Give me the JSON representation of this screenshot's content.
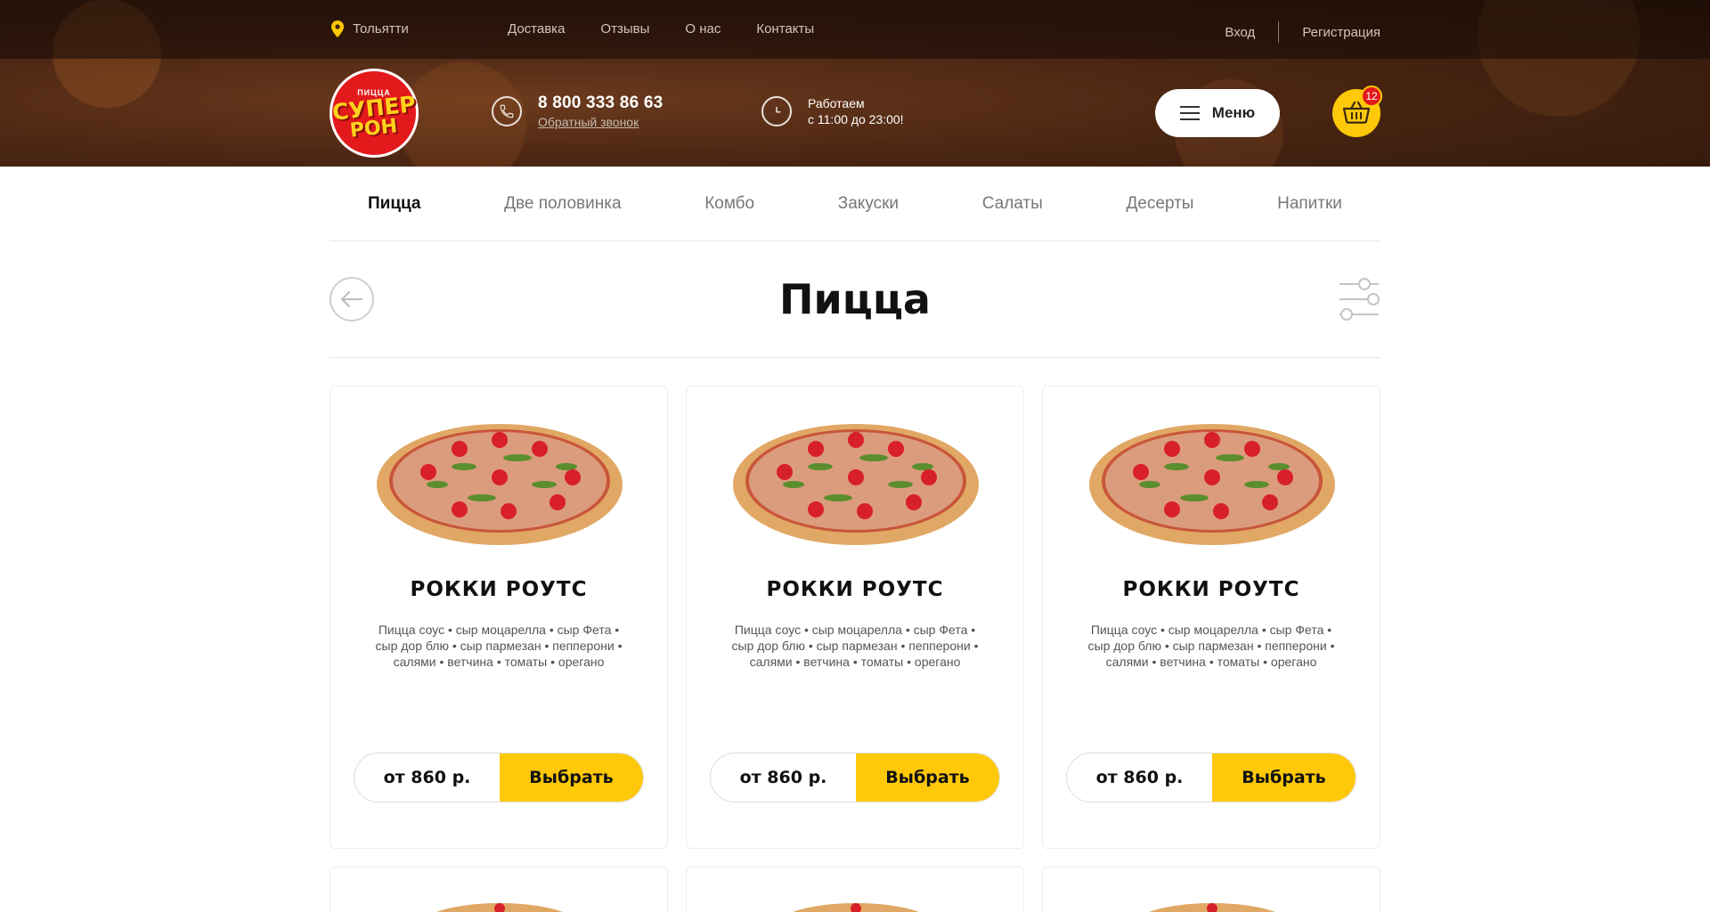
{
  "topbar": {
    "city": "Тольятти",
    "nav": [
      "Доставка",
      "Отзывы",
      "О нас",
      "Контакты"
    ],
    "login": "Вход",
    "register": "Регистрация"
  },
  "header": {
    "logo_small": "ПИЦЦА",
    "logo_line1": "СУПЕР",
    "logo_line2": "РОН",
    "phone": "8 800 333 86 63",
    "callback": "Обратный звонок",
    "hours_line1": "Работаем",
    "hours_line2": "с 11:00 до 23:00!",
    "menu_label": "Меню",
    "cart_count": "12"
  },
  "categories": [
    "Пицца",
    "Две половинка",
    "Комбо",
    "Закуски",
    "Салаты",
    "Десерты",
    "Напитки"
  ],
  "page_title": "Пицца",
  "products": [
    {
      "title": "РОККИ РОУТС",
      "desc": "Пицца соус • сыр моцарелла • сыр Фета • сыр дор блю • сыр пармезан • пепперони • салями • ветчина • томаты • орегано",
      "price": "от 860 р.",
      "action": "Выбрать"
    },
    {
      "title": "РОККИ РОУТС",
      "desc": "Пицца соус • сыр моцарелла • сыр Фета • сыр дор блю • сыр пармезан • пепперони • салями • ветчина • томаты • орегано",
      "price": "от 860 р.",
      "action": "Выбрать"
    },
    {
      "title": "РОККИ РОУТС",
      "desc": "Пицца соус • сыр моцарелла • сыр Фета • сыр дор блю • сыр пармезан • пепперони • салями • ветчина • томаты • орегано",
      "price": "от 860 р.",
      "action": "Выбрать"
    }
  ],
  "icons": {
    "city": "map-pin-icon",
    "phone": "phone-icon",
    "hours": "clock-icon",
    "menu": "burger-icon",
    "cart": "basket-icon",
    "back": "arrow-left-icon",
    "filter": "sliders-icon"
  },
  "colors": {
    "accent": "#ffc808",
    "brand_red": "#e3191b",
    "header_brown": "#4a2512"
  }
}
